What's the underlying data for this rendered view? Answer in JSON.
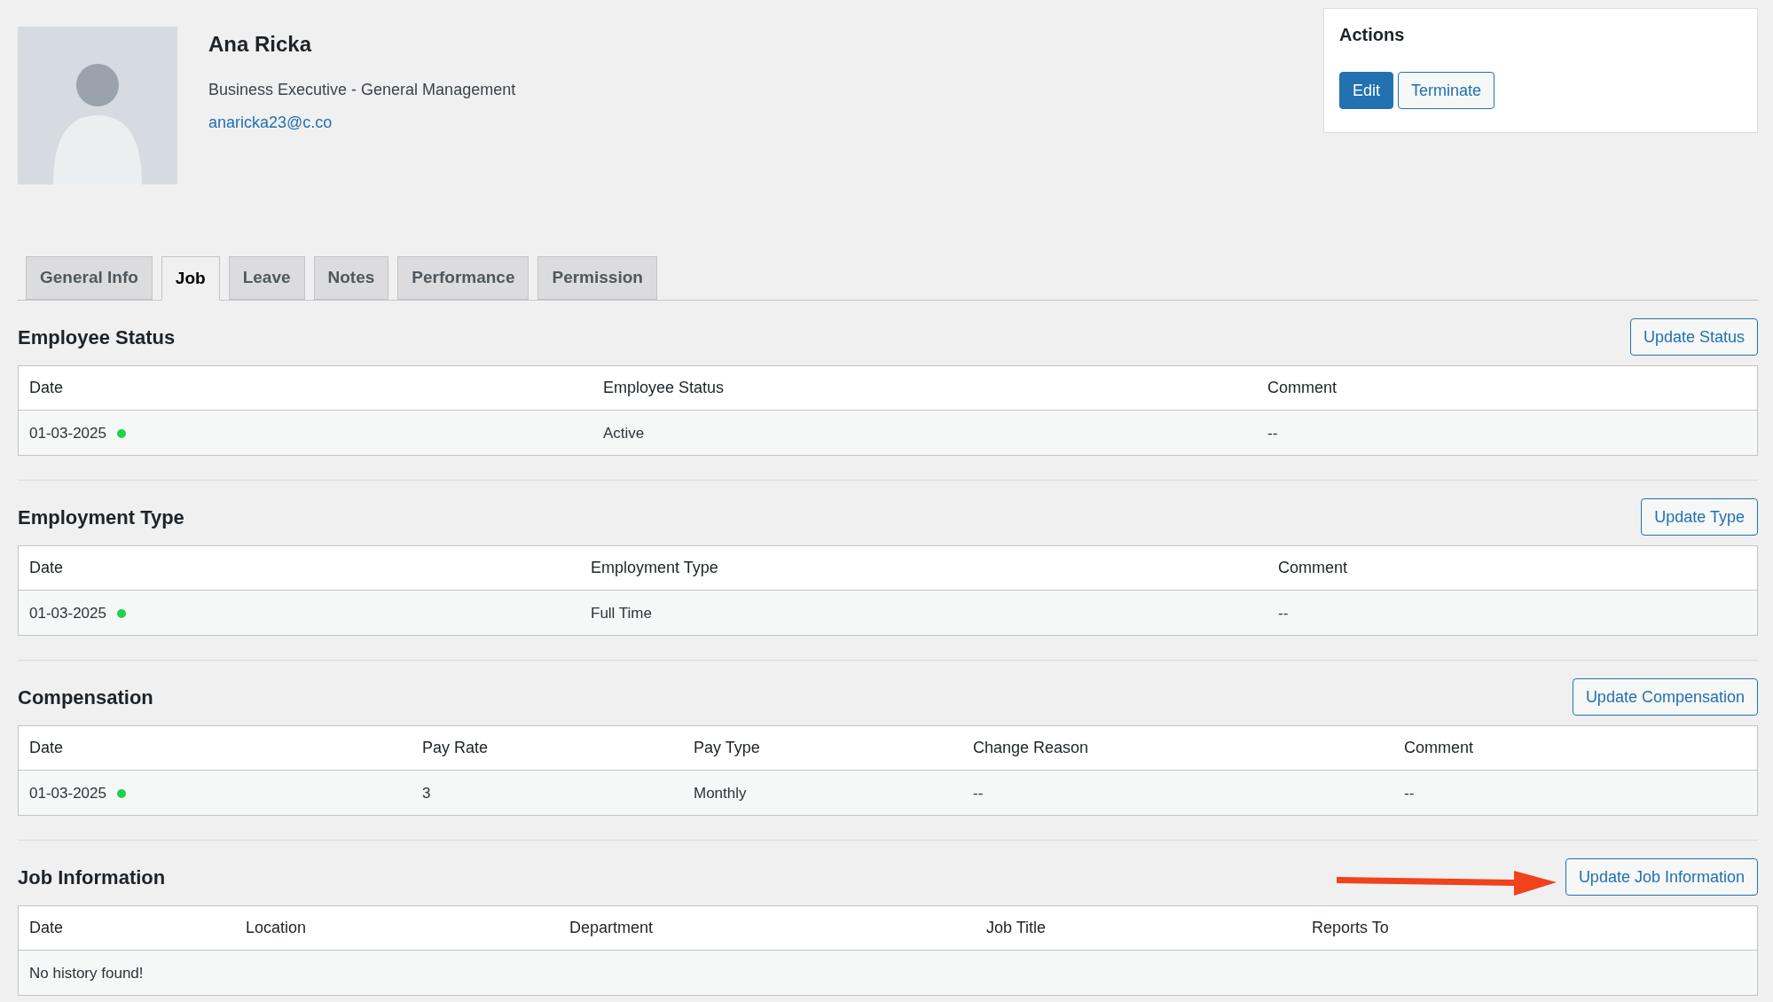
{
  "profile": {
    "name": "Ana Ricka",
    "position": "Business Executive - General Management",
    "email": "anaricka23@c.co"
  },
  "actions": {
    "title": "Actions",
    "buttons": [
      {
        "label": "Edit",
        "kind": "primary"
      },
      {
        "label": "Terminate",
        "kind": "secondary"
      }
    ]
  },
  "tabs": [
    {
      "label": "General Info",
      "selected": false
    },
    {
      "label": "Job",
      "selected": true
    },
    {
      "label": "Leave",
      "selected": false
    },
    {
      "label": "Notes",
      "selected": false
    },
    {
      "label": "Performance",
      "selected": false
    },
    {
      "label": "Permission",
      "selected": false
    }
  ],
  "sections": [
    {
      "title": "Employee Status",
      "button": "Update Status",
      "columns": [
        "Date",
        "Employee Status",
        "Comment"
      ],
      "rows": [
        {
          "cells": [
            "01-03-2025",
            "Active",
            "--"
          ],
          "color": "#1ed14b"
        }
      ]
    },
    {
      "title": "Employment Type",
      "button": "Update Type",
      "columns": [
        "Date",
        "Employment Type",
        "Comment"
      ],
      "rows": [
        {
          "cells": [
            "01-03-2025",
            "Full Time",
            "--"
          ],
          "color": "#1ed14b"
        }
      ]
    },
    {
      "title": "Compensation",
      "button": "Update Compensation",
      "columns": [
        "Date",
        "Pay Rate",
        "Pay Type",
        "Change Reason",
        "Comment"
      ],
      "rows": [
        {
          "cells": [
            "01-03-2025",
            "3",
            "Monthly",
            "--",
            "--"
          ],
          "color": "#1ed14b"
        }
      ]
    },
    {
      "title": "Job Information",
      "button": "Update Job Information",
      "columns": [
        "Date",
        "Location",
        "Department",
        "Job Title",
        "Reports To"
      ],
      "empty_message": "No history found!"
    }
  ]
}
